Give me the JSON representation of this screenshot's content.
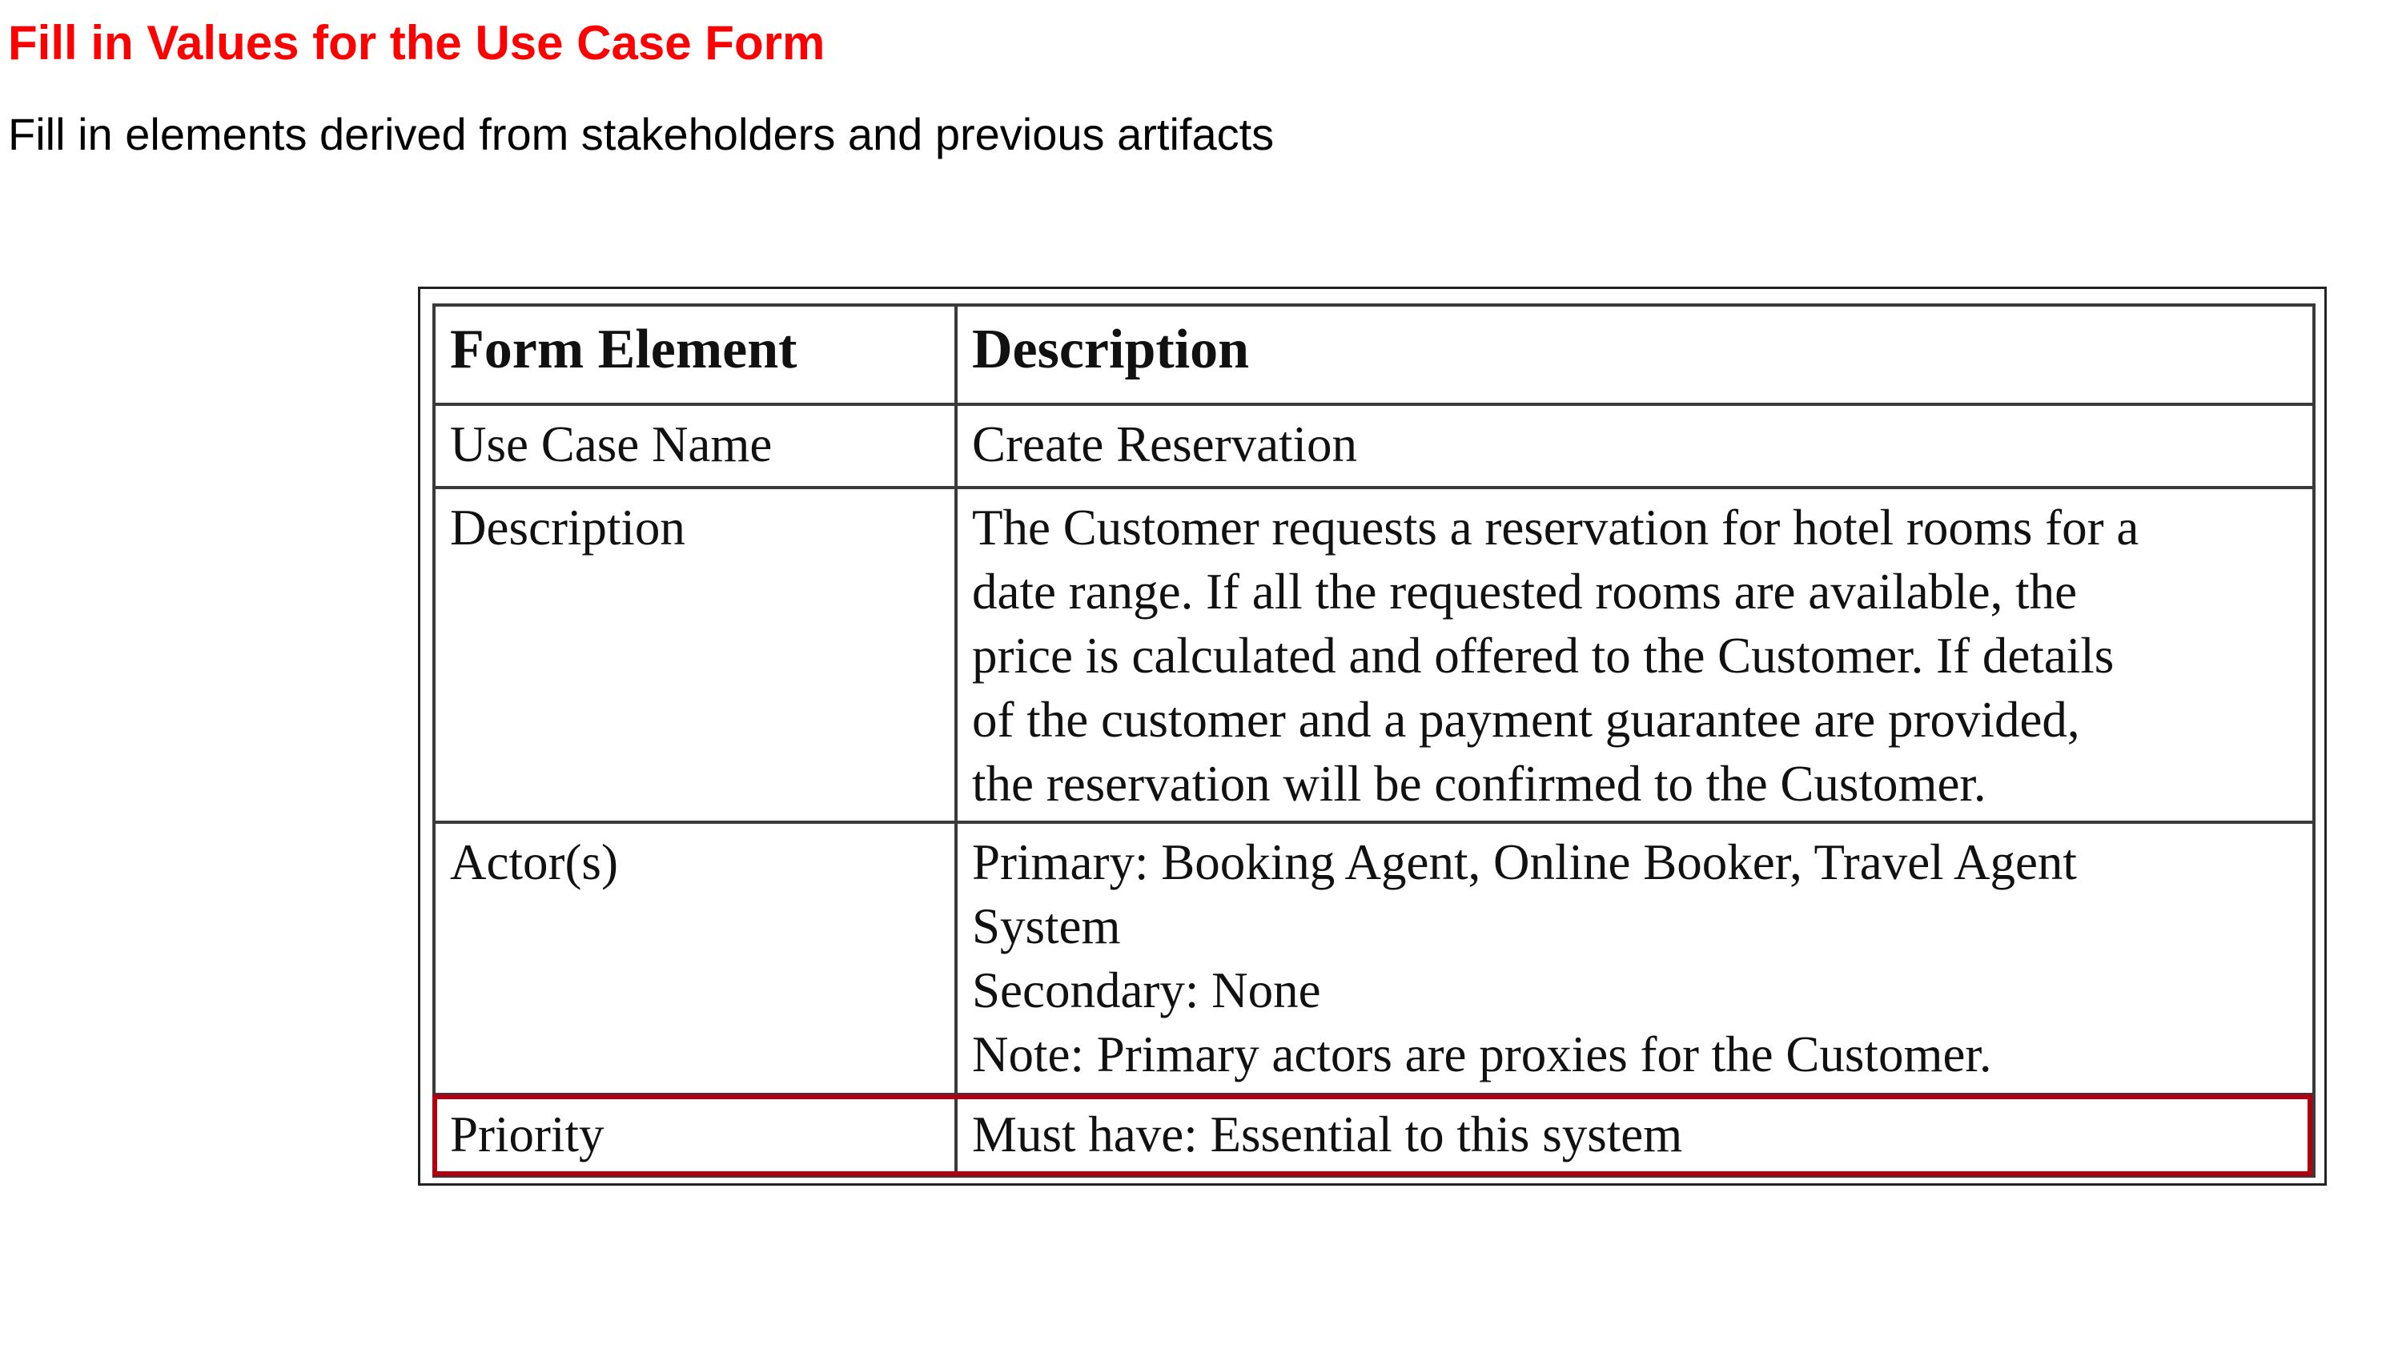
{
  "title": "Fill in Values for the Use Case Form",
  "subtitle": "Fill in elements derived from stakeholders and previous artifacts",
  "colors": {
    "title": "#ff0000",
    "highlight": "#b00010"
  },
  "table": {
    "headers": [
      "Form Element",
      "Description"
    ],
    "rows": {
      "use_case_name": {
        "element": "Use Case Name",
        "description": "Create Reservation"
      },
      "description": {
        "element": "Description",
        "lines": [
          "The Customer requests a reservation for hotel rooms for a",
          "date range. If all the requested rooms are available, the",
          "price is calculated and offered to the Customer. If details",
          "of the customer and a payment guarantee are provided,",
          "the reservation will be confirmed to the Customer."
        ]
      },
      "actors": {
        "element": "Actor(s)",
        "lines": [
          "Primary: Booking Agent, Online Booker, Travel Agent",
          "System",
          "Secondary: None",
          "Note: Primary actors are proxies for the Customer."
        ]
      },
      "priority": {
        "element": "Priority",
        "description": "Must have: Essential to this system",
        "highlighted": true
      }
    }
  }
}
